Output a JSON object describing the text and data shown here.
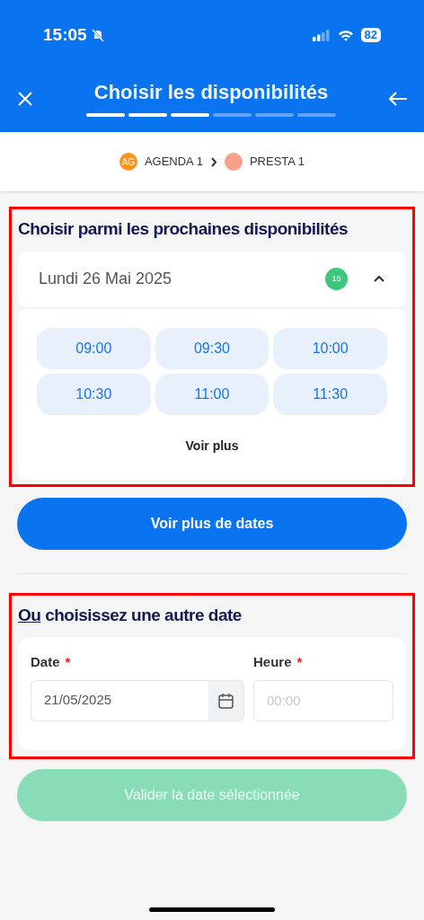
{
  "status_bar": {
    "time": "15:05",
    "battery": "82",
    "silent": true
  },
  "header": {
    "title": "Choisir les disponibilités",
    "steps": [
      {
        "done": true
      },
      {
        "done": true
      },
      {
        "done": true
      },
      {
        "done": false
      },
      {
        "done": false
      },
      {
        "done": false
      }
    ]
  },
  "breadcrumb": [
    {
      "avatar": "AG",
      "label": "AGENDA 1",
      "color": "#f7941d"
    },
    {
      "label": "PRESTA 1",
      "color": "#f9a08c"
    }
  ],
  "next_slots": {
    "title": "Choisir parmi les prochaines disponibilités",
    "highlighted": true,
    "day": {
      "label": "Lundi 26 Mai 2025",
      "count": "18",
      "expanded": true
    },
    "slots": [
      {
        "label": "09:00",
        "selected": false
      },
      {
        "label": "09:30",
        "selected": false
      },
      {
        "label": "10:00",
        "selected": false
      },
      {
        "label": "10:30",
        "selected": false
      },
      {
        "label": "11:00",
        "selected": false
      },
      {
        "label": "11:30",
        "selected": false
      }
    ],
    "more": "Voir plus"
  },
  "more_dates_button": "Voir plus de dates",
  "other_date": {
    "title_lead": "Ou",
    "title_rest": "choisissez une autre date",
    "highlighted": true,
    "date": {
      "label": "Date",
      "required_mark": "*",
      "value": "21/05/2025"
    },
    "time": {
      "label": "Heure",
      "required_mark": "*",
      "placeholder": "00:00"
    }
  },
  "validate_button": {
    "label": "Valider la date sélectionnée",
    "disabled": true
  }
}
